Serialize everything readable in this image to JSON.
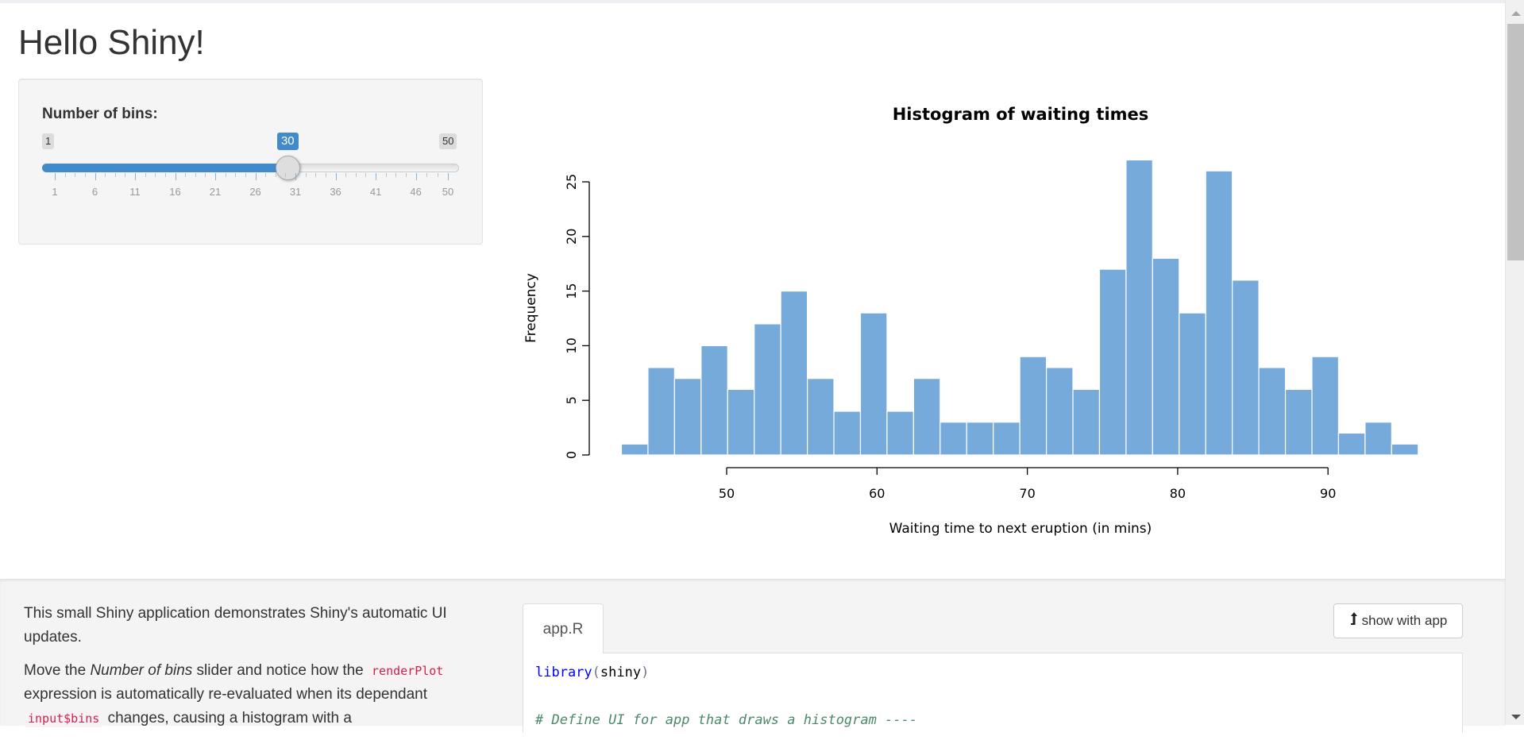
{
  "page": {
    "title": "Hello Shiny!"
  },
  "slider": {
    "label": "Number of bins:",
    "min": 1,
    "max": 50,
    "value": 30,
    "min_label": "1",
    "max_label": "50",
    "value_label": "30",
    "grid_labels": [
      "1",
      "6",
      "11",
      "16",
      "21",
      "26",
      "31",
      "36",
      "41",
      "46",
      "50"
    ]
  },
  "colors": {
    "bar_fill": "#75AADB",
    "bar_border": "#ffffff",
    "accent": "#428bca"
  },
  "chart_data": {
    "type": "bar",
    "title": "Histogram of waiting times",
    "xlabel": "Waiting time to next eruption (in mins)",
    "ylabel": "Frequency",
    "x_range": [
      43,
      96
    ],
    "bins": 30,
    "values": [
      1,
      8,
      7,
      10,
      6,
      12,
      15,
      7,
      4,
      13,
      4,
      7,
      3,
      3,
      3,
      9,
      8,
      6,
      17,
      27,
      18,
      13,
      26,
      16,
      8,
      6,
      9,
      2,
      3,
      1
    ],
    "xticks": [
      50,
      60,
      70,
      80,
      90
    ],
    "xtick_labels": [
      "50",
      "60",
      "70",
      "80",
      "90"
    ],
    "yticks": [
      0,
      5,
      10,
      15,
      20,
      25
    ],
    "ytick_labels": [
      "0",
      "5",
      "10",
      "15",
      "20",
      "25"
    ],
    "ylim": [
      0,
      25
    ],
    "grid": false,
    "legend": "none"
  },
  "description": {
    "p1": "This small Shiny application demonstrates Shiny's automatic UI updates.",
    "p2_before": "Move the ",
    "p2_em": "Number of bins",
    "p2_mid": " slider and notice how the ",
    "p2_code1": "renderPlot",
    "p2_after1": " expression is automatically re-evaluated when its dependant ",
    "p2_code2": "input$bins",
    "p2_after2": " changes, causing a histogram with a"
  },
  "code_viewer": {
    "tab_label": "app.R",
    "show_button_label": "show with app",
    "lines": {
      "l1_fn": "library",
      "l1_open": "(",
      "l1_arg": "shiny",
      "l1_close": ")",
      "l3_comment": "# Define UI for app that draws a histogram ----"
    }
  }
}
